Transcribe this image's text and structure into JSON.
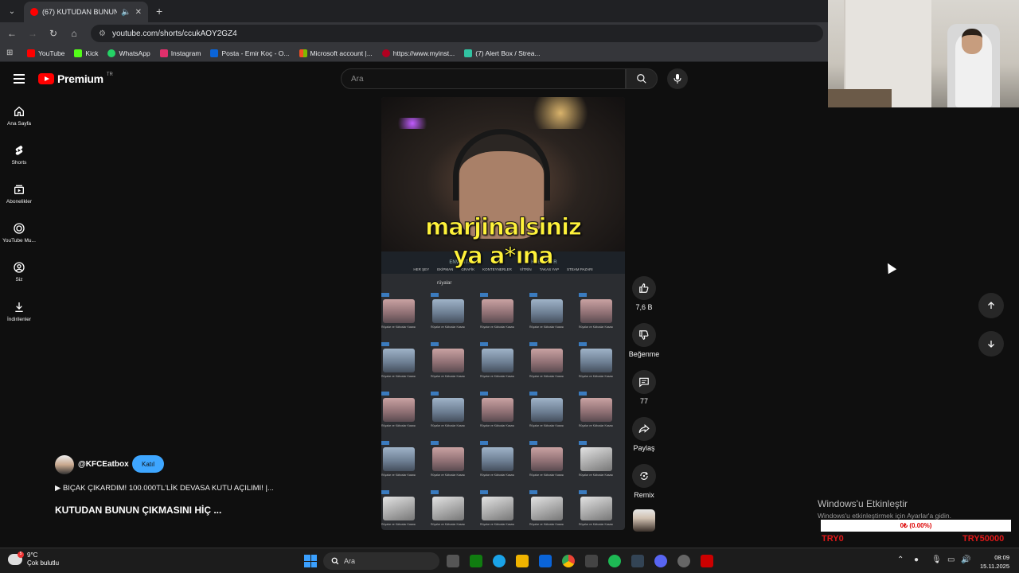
{
  "browser": {
    "tab_title": "(67) KUTUDAN BUNUN ÇIK",
    "url": "youtube.com/shorts/ccukAOY2GZ4",
    "bookmarks": [
      {
        "label": "YouTube",
        "color": "#ff0000"
      },
      {
        "label": "Kick",
        "color": "#53fc18"
      },
      {
        "label": "WhatsApp",
        "color": "#25d366"
      },
      {
        "label": "Instagram",
        "color": "#e1306c"
      },
      {
        "label": "Posta - Emir Koç - O...",
        "color": "#0a64d8"
      },
      {
        "label": "Microsoft account |...",
        "color": "#f25022"
      },
      {
        "label": "https://www.myinst...",
        "color": "#b00020"
      },
      {
        "label": "(7) Alert Box / Strea...",
        "color": "#31c3a2"
      }
    ]
  },
  "header": {
    "logo": "Premium",
    "country": "TR",
    "search_placeholder": "Ara"
  },
  "sidebar": {
    "items": [
      {
        "label": "Ana Sayfa",
        "icon": "home-icon"
      },
      {
        "label": "Shorts",
        "icon": "shorts-icon"
      },
      {
        "label": "Abonelikler",
        "icon": "subscriptions-icon"
      },
      {
        "label": "YouTube Mu...",
        "icon": "youtube-music-icon"
      },
      {
        "label": "Siz",
        "icon": "you-icon"
      },
      {
        "label": "İndirilenler",
        "icon": "downloads-icon"
      }
    ]
  },
  "video": {
    "caption_line1": "marjinalsiniz",
    "caption_line2": "ya a*ına",
    "game_nav": [
      "ENVANTER",
      "HABERLER"
    ],
    "game_tabs": [
      "HER ŞEY",
      "EKİPMAN",
      "GRAFİK",
      "KONTEYNERLER",
      "VİTRİN",
      "TAKAS YAP",
      "STEAM PAZARI"
    ],
    "game_search": "rüyalar",
    "case_label": "Rüyalar ve Kâbuslar Kasası",
    "key_label": "Rüyalar ve Kâbuslar Kasası Anahtarı"
  },
  "actions": {
    "like_count": "7,6 B",
    "dislike_label": "Beğenme",
    "comment_count": "77",
    "share_label": "Paylaş",
    "remix_label": "Remix"
  },
  "channel": {
    "name": "@KFCEatbox",
    "join_label": "Katıl",
    "playlist": "▶ BIÇAK ÇIKARDIM! 100.000TL'LİK DEVASA KUTU AÇILIMI! |...",
    "title": "KUTUDAN BUNUN ÇIKMASINI HİÇ ..."
  },
  "overlay": {
    "activate_title": "Windows'u Etkinleştir",
    "activate_sub": "Windows'u etkinleştirmek için Ayarlar'a gidin.",
    "ticker": "0₺ (0.00%)",
    "try_left": "TRY0",
    "try_right": "TRY50000"
  },
  "taskbar": {
    "temp": "9°C",
    "weather": "Çok bulutlu",
    "weather_badge": "5",
    "search": "Ara",
    "time": "08:09",
    "date": "15.11.2025"
  }
}
